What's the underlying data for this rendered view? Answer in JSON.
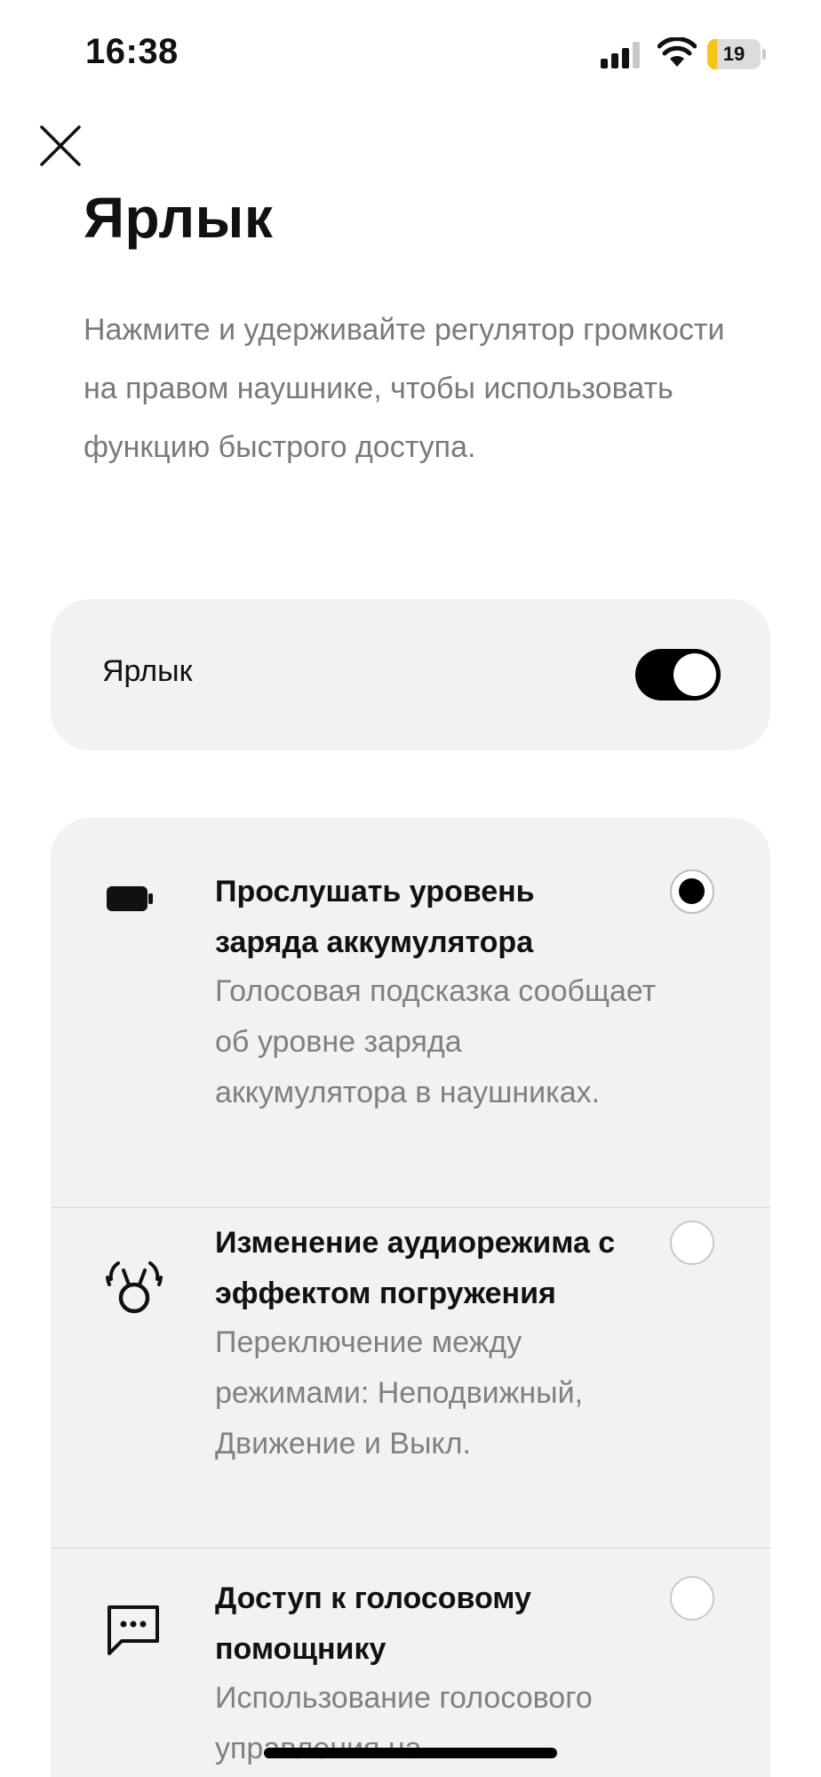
{
  "status_bar": {
    "time": "16:38",
    "battery_level": "19",
    "battery_fraction": 0.19,
    "signal_icon": "cellular-signal-icon",
    "wifi_icon": "wifi-icon"
  },
  "header": {
    "close_icon": "close-icon",
    "title": "Ярлык",
    "description": "Нажмите и удерживайте регулятор громкости на правом наушнике, чтобы использовать функцию быстрого доступа."
  },
  "toggle": {
    "label": "Ярлык",
    "enabled": true
  },
  "options": [
    {
      "icon": "battery-icon",
      "title": "Прослушать уровень заряда аккумулятора",
      "description": "Голосовая подсказка сообщает об уровне заряда аккумулятора в наушниках.",
      "selected": true
    },
    {
      "icon": "immersive-audio-icon",
      "title": "Изменение аудиорежима с эффектом погружения",
      "description": "Переключение между режимами: Неподвижный, Движение и Выкл.",
      "selected": false
    },
    {
      "icon": "voice-assistant-chat-icon",
      "title": "Доступ к голосовому помощнику",
      "description": "Использование голосового управления на",
      "selected": false
    }
  ],
  "colors": {
    "accent": "#000000",
    "card_background": "#f2f2f2",
    "secondary_text": "#7a7a7a",
    "battery_fill": "#f5c518"
  }
}
